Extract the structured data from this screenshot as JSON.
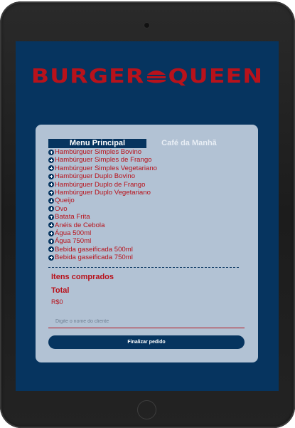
{
  "brand": {
    "logo_left": "BURGER",
    "logo_right": "QUEEN",
    "logo_color": "#b8121b"
  },
  "colors": {
    "screen_bg": "#06345f",
    "card_bg": "#b2c2d4",
    "accent": "#b8121b"
  },
  "tabs": [
    {
      "label": "Menu Principal",
      "active": true
    },
    {
      "label": "Café da Manhã",
      "active": false
    }
  ],
  "menu": {
    "add_icon": "plus-circle-icon",
    "items": [
      "Hambúrguer Simples Bovino",
      "Hambúrguer Simples de Frango",
      "Hambúrguer Simples Vegetariano",
      "Hambúrguer Duplo Bovino",
      "Hambúrguer Duplo de Frango",
      "Hambúrguer Duplo Vegetariano",
      "Queijo",
      "Ovo",
      "Batata Frita",
      "Anéis de Cebola",
      "Água 500ml",
      "Água 750ml",
      "Bebida gaseificada 500ml",
      "Bebida gaseificada 750ml"
    ]
  },
  "order": {
    "items_title": "Itens comprados",
    "total_label": "Total",
    "total_value": "R$0",
    "client_placeholder": "Digite o nome do cliente",
    "finish_label": "Finalizar pedido"
  }
}
